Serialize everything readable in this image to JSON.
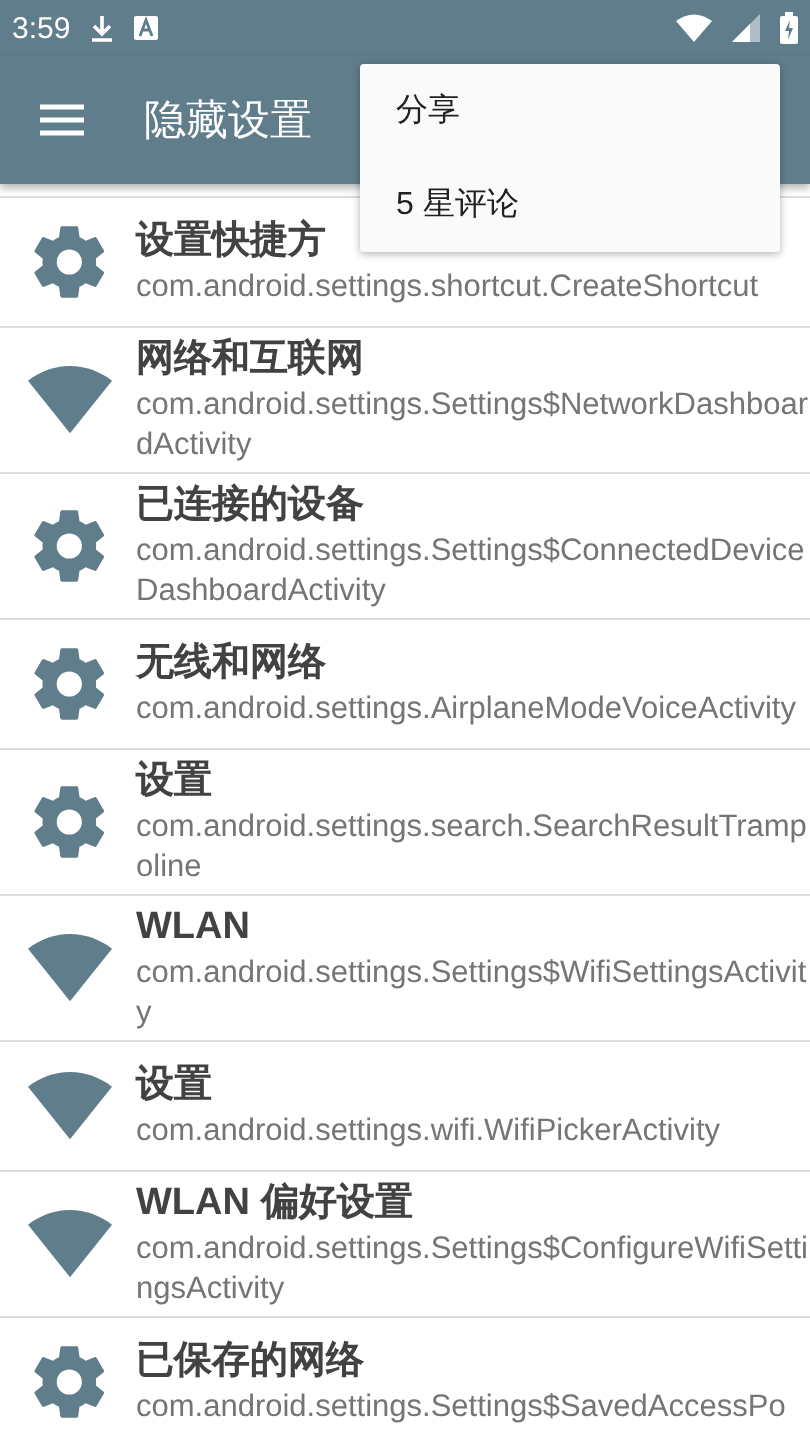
{
  "status_bar": {
    "time": "3:59"
  },
  "toolbar": {
    "title": "隐藏设置"
  },
  "menu": {
    "items": [
      "分享",
      "5 星评论"
    ]
  },
  "list": [
    {
      "kind": "gear",
      "title": "设置快捷方",
      "subtitle": "com.android.settings.shortcut.CreateShortcut"
    },
    {
      "kind": "wifi",
      "title": "网络和互联网",
      "subtitle": "com.android.settings.Settings$NetworkDashboardActivity"
    },
    {
      "kind": "gear",
      "title": "已连接的设备",
      "subtitle": "com.android.settings.Settings$ConnectedDeviceDashboardActivity"
    },
    {
      "kind": "gear",
      "title": "无线和网络",
      "subtitle": "com.android.settings.AirplaneModeVoiceActivity"
    },
    {
      "kind": "gear",
      "title": "设置",
      "subtitle": "com.android.settings.search.SearchResultTrampoline"
    },
    {
      "kind": "wifi",
      "title": "WLAN",
      "subtitle": "com.android.settings.Settings$WifiSettingsActivity"
    },
    {
      "kind": "wifi",
      "title": "设置",
      "subtitle": "com.android.settings.wifi.WifiPickerActivity"
    },
    {
      "kind": "wifi",
      "title": "WLAN 偏好设置",
      "subtitle": "com.android.settings.Settings$ConfigureWifiSettingsActivity"
    },
    {
      "kind": "gear",
      "title": "已保存的网络",
      "subtitle": "com.android.settings.Settings$SavedAccessPo"
    }
  ]
}
